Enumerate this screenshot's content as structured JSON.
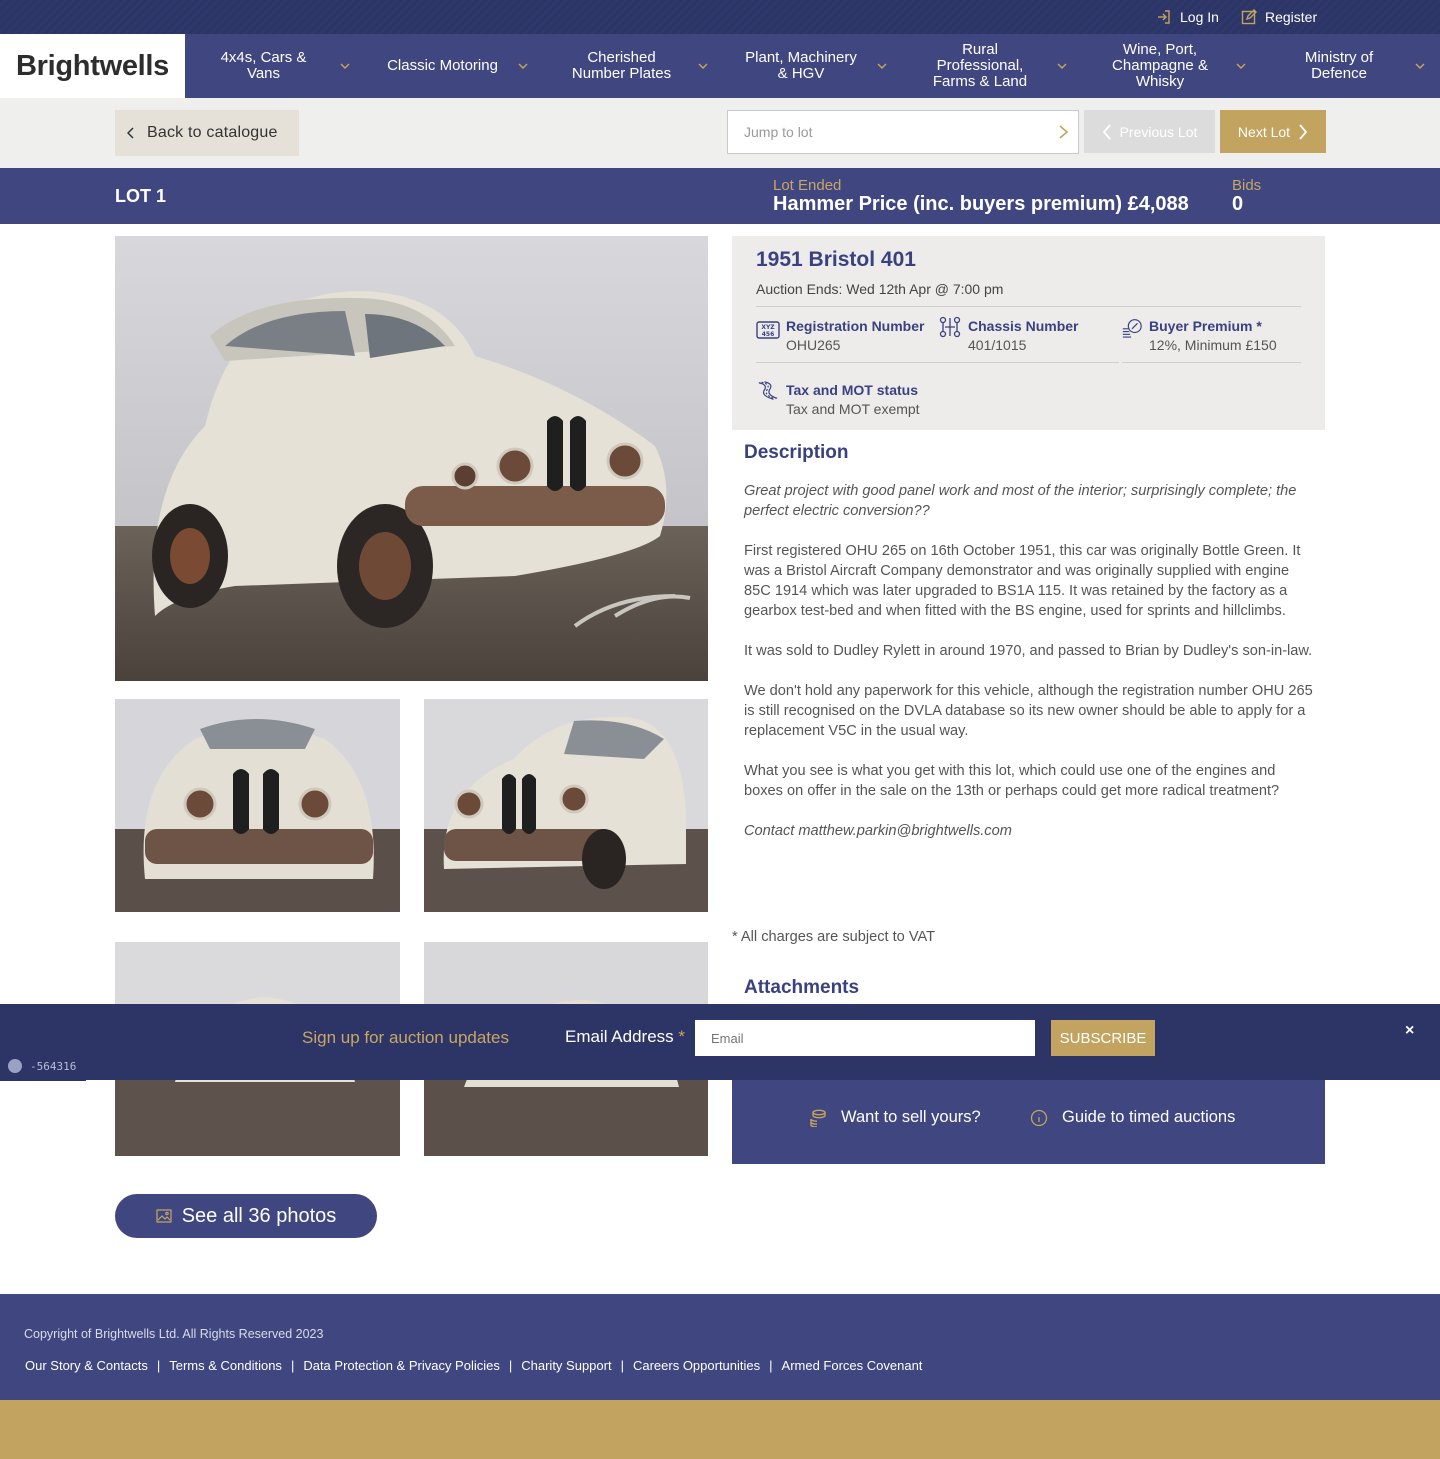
{
  "utility": {
    "login_label": "Log In",
    "register_label": "Register"
  },
  "brand": {
    "logo_text": "Brightwells"
  },
  "nav": {
    "items": [
      {
        "label": "4x4s, Cars & Vans"
      },
      {
        "label": "Classic Motoring"
      },
      {
        "label": "Cherished Number Plates"
      },
      {
        "label": "Plant, Machinery & HGV"
      },
      {
        "label": "Rural Professional, Farms & Land"
      },
      {
        "label": "Wine, Port, Champagne & Whisky"
      },
      {
        "label": "Ministry of Defence"
      }
    ]
  },
  "lot_toolbar": {
    "back_label": "Back to catalogue",
    "jump_placeholder": "Jump to lot",
    "prev_label": "Previous Lot",
    "next_label": "Next Lot"
  },
  "lot_band": {
    "lot_label": "LOT 1",
    "status_label": "Lot Ended",
    "price_text": "Hammer Price (inc. buyers premium) £4,088",
    "bids_label": "Bids",
    "bids_value": "0"
  },
  "details": {
    "title": "1951 Bristol 401",
    "auction_ends": "Auction Ends: Wed 12th Apr @ 7:00 pm",
    "specs": {
      "registration": {
        "title": "Registration Number",
        "value": "OHU265",
        "icon": "registration-plate-icon"
      },
      "chassis": {
        "title": "Chassis Number",
        "value": "401/1015",
        "icon": "chassis-icon"
      },
      "premium": {
        "title": "Buyer Premium *",
        "value": "12%, Minimum £150",
        "icon": "coins-percent-icon"
      },
      "tax": {
        "title": "Tax and MOT status",
        "value": "Tax and MOT exempt",
        "icon": "road-icon"
      }
    }
  },
  "description": {
    "heading": "Description",
    "intro": "Great project with good panel work and most of the interior; surprisingly complete; the perfect electric conversion??",
    "paragraphs": [
      "First registered OHU 265 on 16th October 1951, this car was originally Bottle Green. It was a Bristol Aircraft Company demonstrator and was originally supplied with engine 85C 1914 which was later upgraded to BS1A 115. It was retained by the factory as a gearbox test-bed and when fitted with the BS engine, used for sprints and hillclimbs.",
      "It was sold to Dudley Rylett in around 1970, and passed to Brian by Dudley's son-in-law.",
      "We don't hold any paperwork for this vehicle, although the registration number OHU 265 is still recognised on the DVLA database so its new owner should be able to apply for a replacement V5C in the usual way.",
      "What you see is what you get with this lot, which could use one of the engines and boxes on offer in the sale on the 13th or perhaps could get more radical treatment?"
    ],
    "contact": "Contact matthew.parkin@brightwells.com",
    "vat_note": "* All charges are subject to VAT",
    "attachments_heading": "Attachments"
  },
  "sell_panel": {
    "sell_label": "Want to sell yours?",
    "guide_label": "Guide to timed auctions"
  },
  "photos": {
    "see_all_label": "See all 36 photos"
  },
  "signup": {
    "title": "Sign up for auction updates",
    "email_label": "Email Address",
    "required_mark": "*",
    "email_placeholder": "Email",
    "subscribe_label": "SUBSCRIBE",
    "close_label": "×"
  },
  "debug": {
    "value": "-564316"
  },
  "footer": {
    "copyright": "Copyright of Brightwells Ltd. All Rights Reserved 2023",
    "links": [
      "Our Story & Contacts",
      "Terms & Conditions",
      "Data Protection & Privacy Policies",
      "Charity Support",
      "Careers Opportunities",
      "Armed Forces Covenant"
    ]
  },
  "colors": {
    "navy": "#40467f",
    "dark_navy": "#2c3565",
    "gold": "#c2a35f",
    "light_gray": "#efefed"
  }
}
